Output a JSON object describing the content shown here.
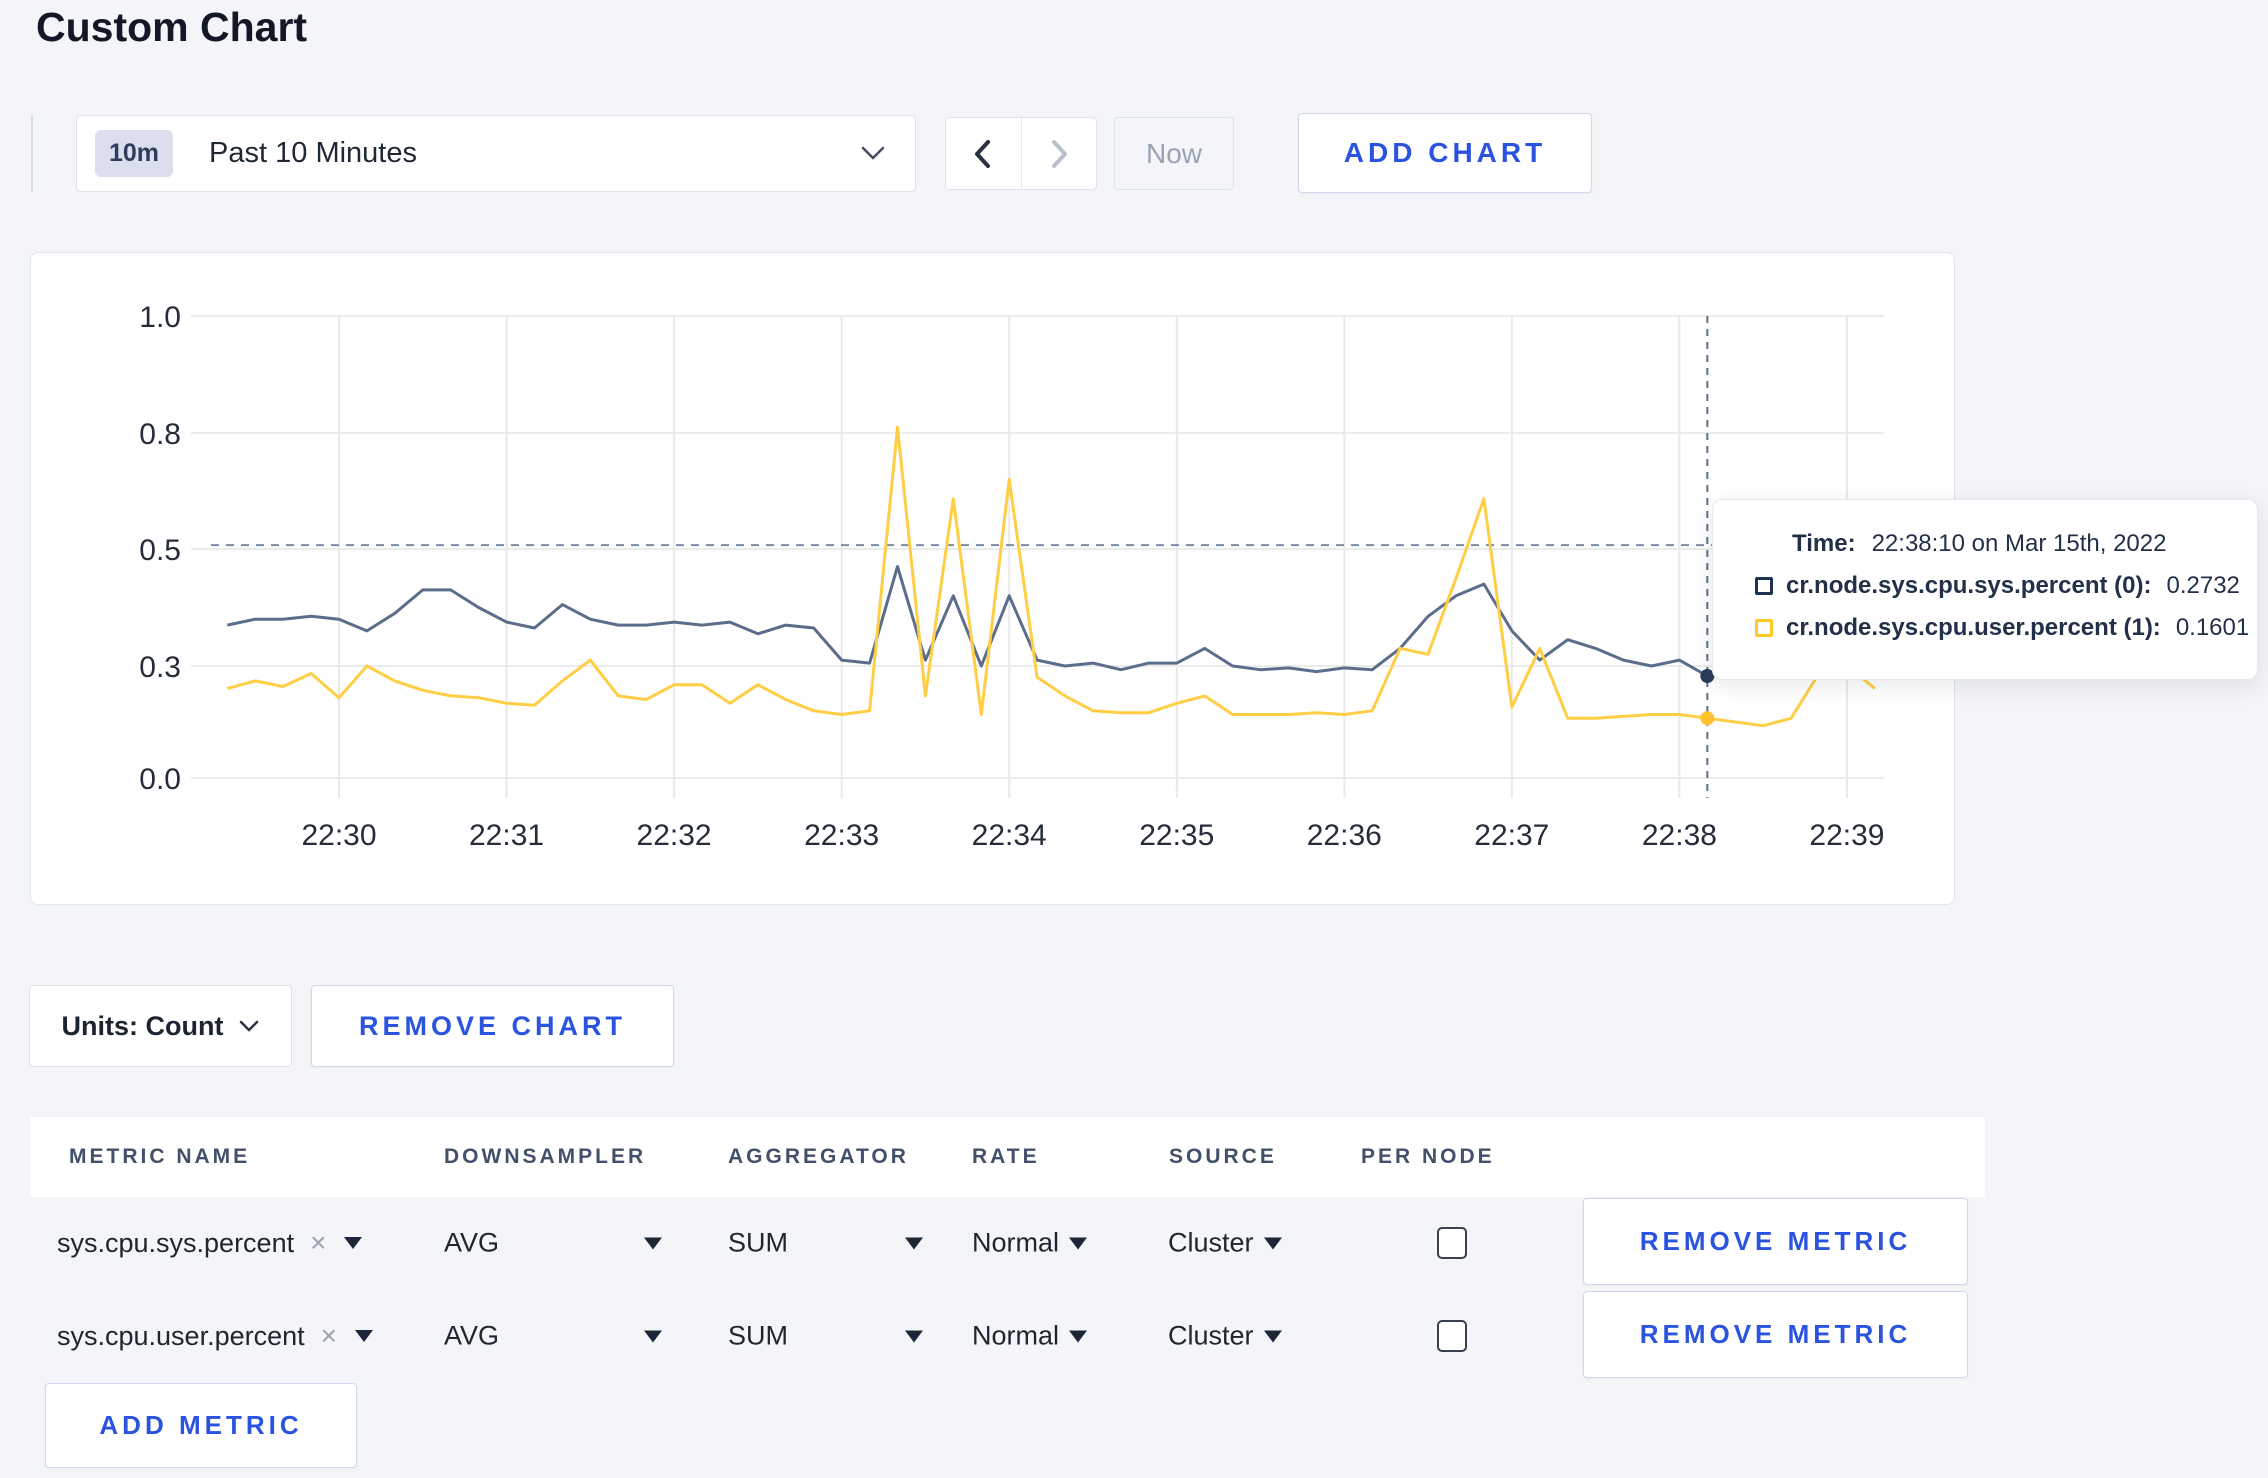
{
  "page": {
    "title": "Custom Chart"
  },
  "toolbar": {
    "time_window": {
      "badge": "10m",
      "label": "Past 10 Minutes"
    },
    "now_label": "Now",
    "add_chart_label": "ADD CHART"
  },
  "icons": {
    "clear": "×"
  },
  "tooltip": {
    "time_label": "Time:",
    "time_value": "22:38:10 on Mar 15th, 2022",
    "rows": [
      {
        "name": "cr.node.sys.cpu.sys.percent (0):",
        "value": "0.2732",
        "color": "#203253"
      },
      {
        "name": "cr.node.sys.cpu.user.percent (1):",
        "value": "0.1601",
        "color": "#ffc92e"
      }
    ]
  },
  "chart_footer": {
    "units_label": "Units: Count",
    "remove_chart_label": "REMOVE CHART"
  },
  "metrics_table": {
    "headers": [
      "METRIC NAME",
      "DOWNSAMPLER",
      "AGGREGATOR",
      "RATE",
      "SOURCE",
      "PER NODE"
    ],
    "rows": [
      {
        "metric": "sys.cpu.sys.percent",
        "downsampler": "AVG",
        "aggregator": "SUM",
        "rate": "Normal",
        "source": "Cluster",
        "per_node_checked": false,
        "remove_label": "REMOVE METRIC"
      },
      {
        "metric": "sys.cpu.user.percent",
        "downsampler": "AVG",
        "aggregator": "SUM",
        "rate": "Normal",
        "source": "Cluster",
        "per_node_checked": false,
        "remove_label": "REMOVE METRIC"
      }
    ],
    "add_metric_label": "ADD METRIC"
  },
  "chart_data": {
    "type": "line",
    "title": "",
    "grid": true,
    "legend_position": "none",
    "x_axis": {
      "labels": [
        "22:30",
        "22:31",
        "22:32",
        "22:33",
        "22:34",
        "22:35",
        "22:36",
        "22:37",
        "22:38",
        "22:39"
      ]
    },
    "y_axis": {
      "ticks": [
        0.0,
        0.3,
        0.5,
        0.8,
        1.0
      ],
      "tick_labels": [
        "0.0",
        "0.3",
        "0.5",
        "0.8",
        "1.0"
      ],
      "range": [
        0.0,
        1.0
      ]
    },
    "start_time": "22:29:20",
    "interval_seconds": 10,
    "series": [
      {
        "name": "cr.node.sys.cpu.sys.percent",
        "color": "#5c6d8c",
        "dot_color": "#2c3c59",
        "values": [
          0.37,
          0.38,
          0.38,
          0.385,
          0.38,
          0.36,
          0.39,
          0.43,
          0.43,
          0.4,
          0.375,
          0.365,
          0.405,
          0.38,
          0.37,
          0.37,
          0.375,
          0.37,
          0.375,
          0.355,
          0.37,
          0.365,
          0.31,
          0.305,
          0.47,
          0.31,
          0.42,
          0.3,
          0.42,
          0.31,
          0.3,
          0.305,
          0.29,
          0.305,
          0.305,
          0.33,
          0.3,
          0.29,
          0.295,
          0.285,
          0.295,
          0.29,
          0.33,
          0.385,
          0.42,
          0.44,
          0.36,
          0.31,
          0.345,
          0.33,
          0.31,
          0.3,
          0.31,
          0.2732,
          0.3,
          0.315,
          0.33,
          0.31,
          0.3,
          0.31
        ]
      },
      {
        "name": "cr.node.sys.cpu.user.percent",
        "color": "#ffce44",
        "dot_color": "#fec32d",
        "values": [
          0.24,
          0.26,
          0.245,
          0.28,
          0.215,
          0.3,
          0.26,
          0.235,
          0.22,
          0.215,
          0.2,
          0.195,
          0.26,
          0.31,
          0.22,
          0.21,
          0.25,
          0.25,
          0.2,
          0.25,
          0.21,
          0.18,
          0.17,
          0.18,
          0.81,
          0.22,
          0.63,
          0.17,
          0.68,
          0.27,
          0.22,
          0.18,
          0.175,
          0.175,
          0.2,
          0.22,
          0.17,
          0.17,
          0.17,
          0.175,
          0.17,
          0.18,
          0.33,
          0.32,
          0.45,
          0.63,
          0.19,
          0.33,
          0.16,
          0.16,
          0.165,
          0.17,
          0.17,
          0.1601,
          0.15,
          0.14,
          0.16,
          0.28,
          0.3,
          0.24
        ]
      }
    ],
    "crosshair": {
      "time": "22:38:10",
      "value_line": 0.51,
      "values": [
        0.2732,
        0.1601
      ]
    }
  }
}
